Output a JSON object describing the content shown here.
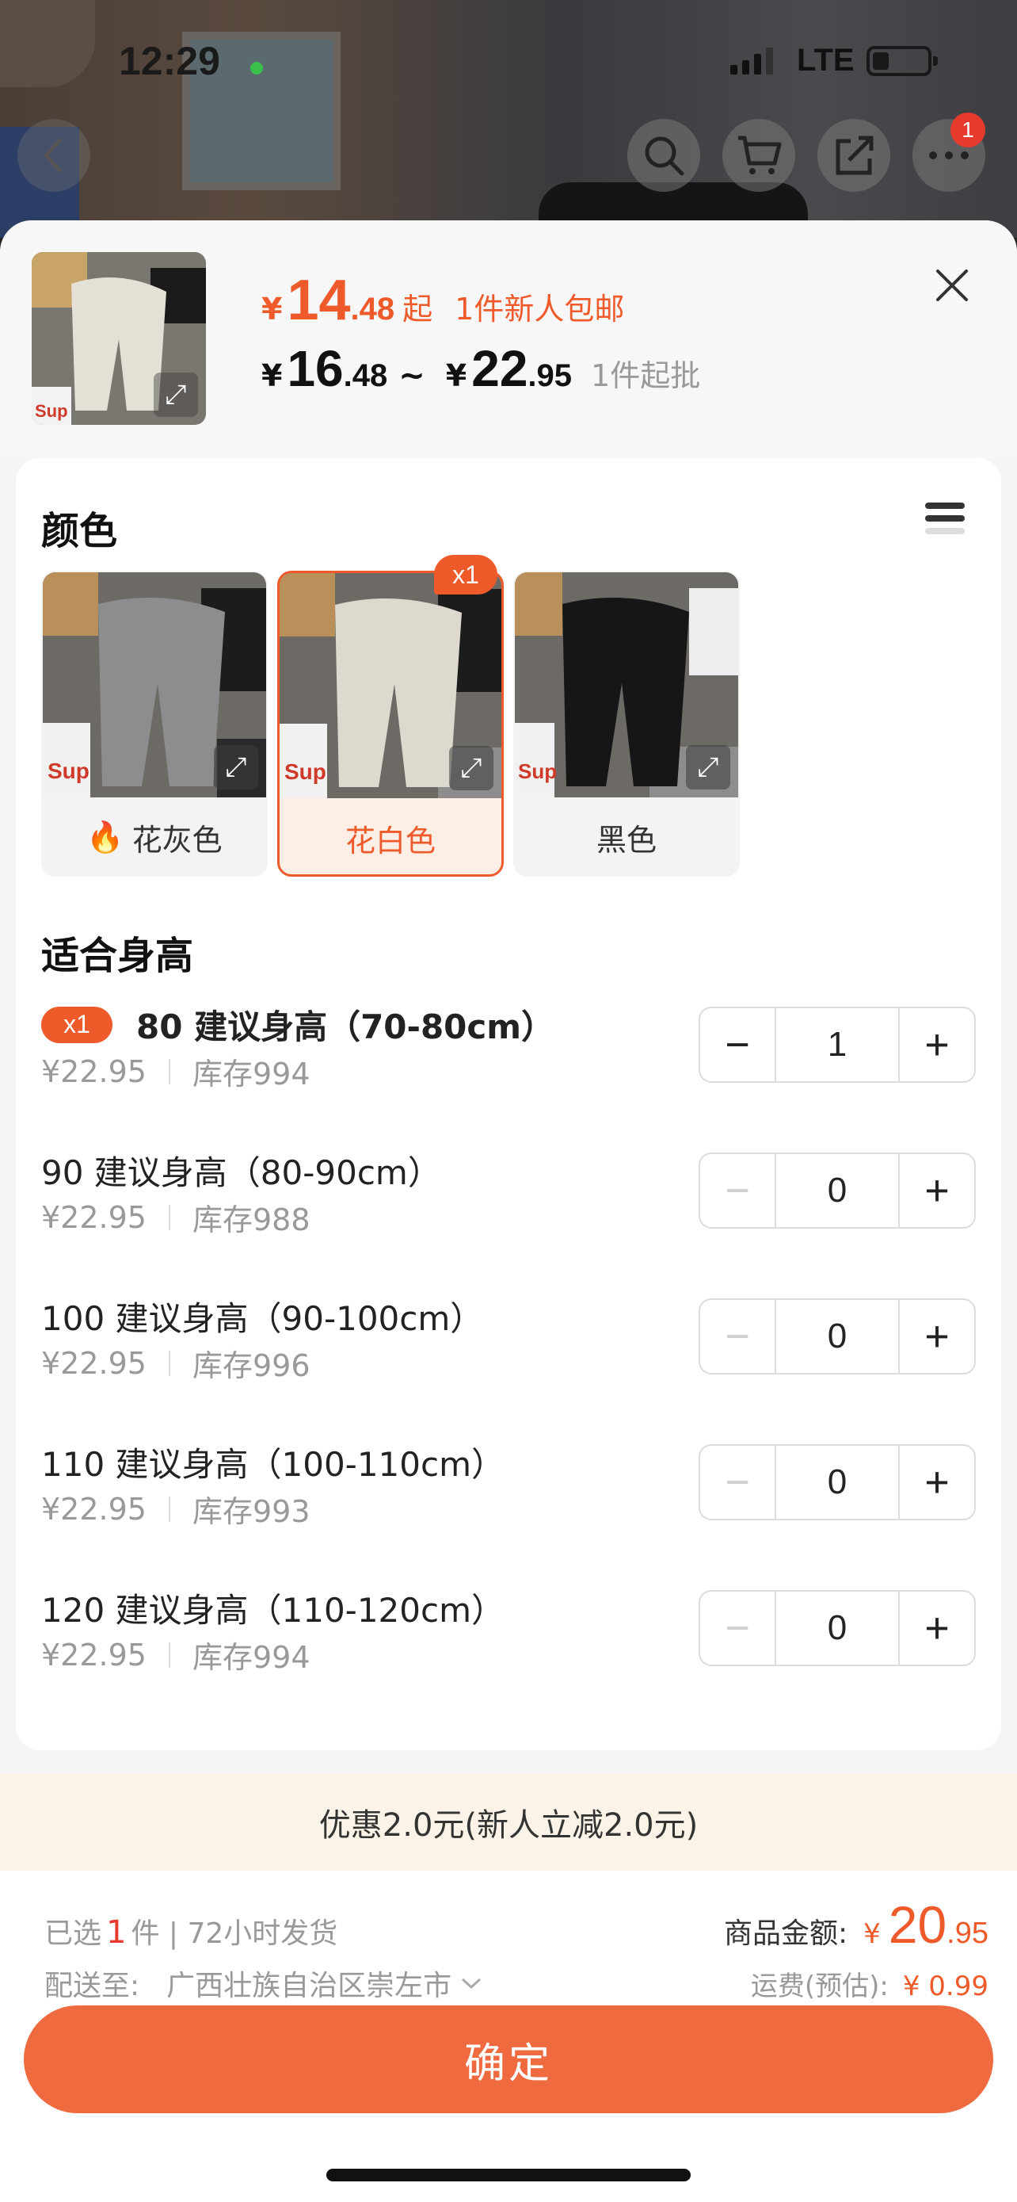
{
  "status_bar": {
    "time": "12:29",
    "network": "LTE"
  },
  "nav": {
    "cart_badge": "1"
  },
  "header": {
    "yen": "¥",
    "price_int": "14",
    "price_dec": ".48",
    "price_suffix": "起",
    "promo": "1件新人包邮",
    "range_low_int": "16",
    "range_low_dec": ".48",
    "range_sep": "~",
    "range_high_int": "22",
    "range_high_dec": ".95",
    "min_order": "1件起批"
  },
  "color_section": {
    "title": "颜色",
    "selected_tag": "x1",
    "options": [
      {
        "label": "花灰色",
        "hot": true,
        "swatch": "#8a8a8a"
      },
      {
        "label": "花白色",
        "hot": false,
        "swatch": "#d9d4c9",
        "selected": true
      },
      {
        "label": "黑色",
        "hot": false,
        "swatch": "#1b1b1b"
      }
    ]
  },
  "size_section": {
    "title": "适合身高",
    "rows": [
      {
        "name": "80 建议身高（70-80cm）",
        "price": "¥22.95",
        "stock": "库存994",
        "qty": "1",
        "tag": "x1"
      },
      {
        "name": "90 建议身高（80-90cm）",
        "price": "¥22.95",
        "stock": "库存988",
        "qty": "0"
      },
      {
        "name": "100 建议身高（90-100cm）",
        "price": "¥22.95",
        "stock": "库存996",
        "qty": "0"
      },
      {
        "name": "110 建议身高（100-110cm）",
        "price": "¥22.95",
        "stock": "库存993",
        "qty": "0"
      },
      {
        "name": "120 建议身高（110-120cm）",
        "price": "¥22.95",
        "stock": "库存994",
        "qty": "0"
      }
    ]
  },
  "discount": {
    "text": "优惠2.0元(新人立减2.0元)"
  },
  "footer": {
    "selected_prefix": "已选",
    "selected_count": "1",
    "selected_suffix": "件 | 72小时发货",
    "ship_label": "配送至:",
    "ship_address": "广西壮族自治区崇左市",
    "amount_label": "商品金额:",
    "amount_yen": "¥",
    "amount_int": "20",
    "amount_dec": ".95",
    "fee_label": "运费(预估):",
    "fee_value": "¥ 0.99",
    "confirm": "确定"
  },
  "colors": {
    "accent": "#ef5a2b",
    "button": "#ef6a3e"
  }
}
